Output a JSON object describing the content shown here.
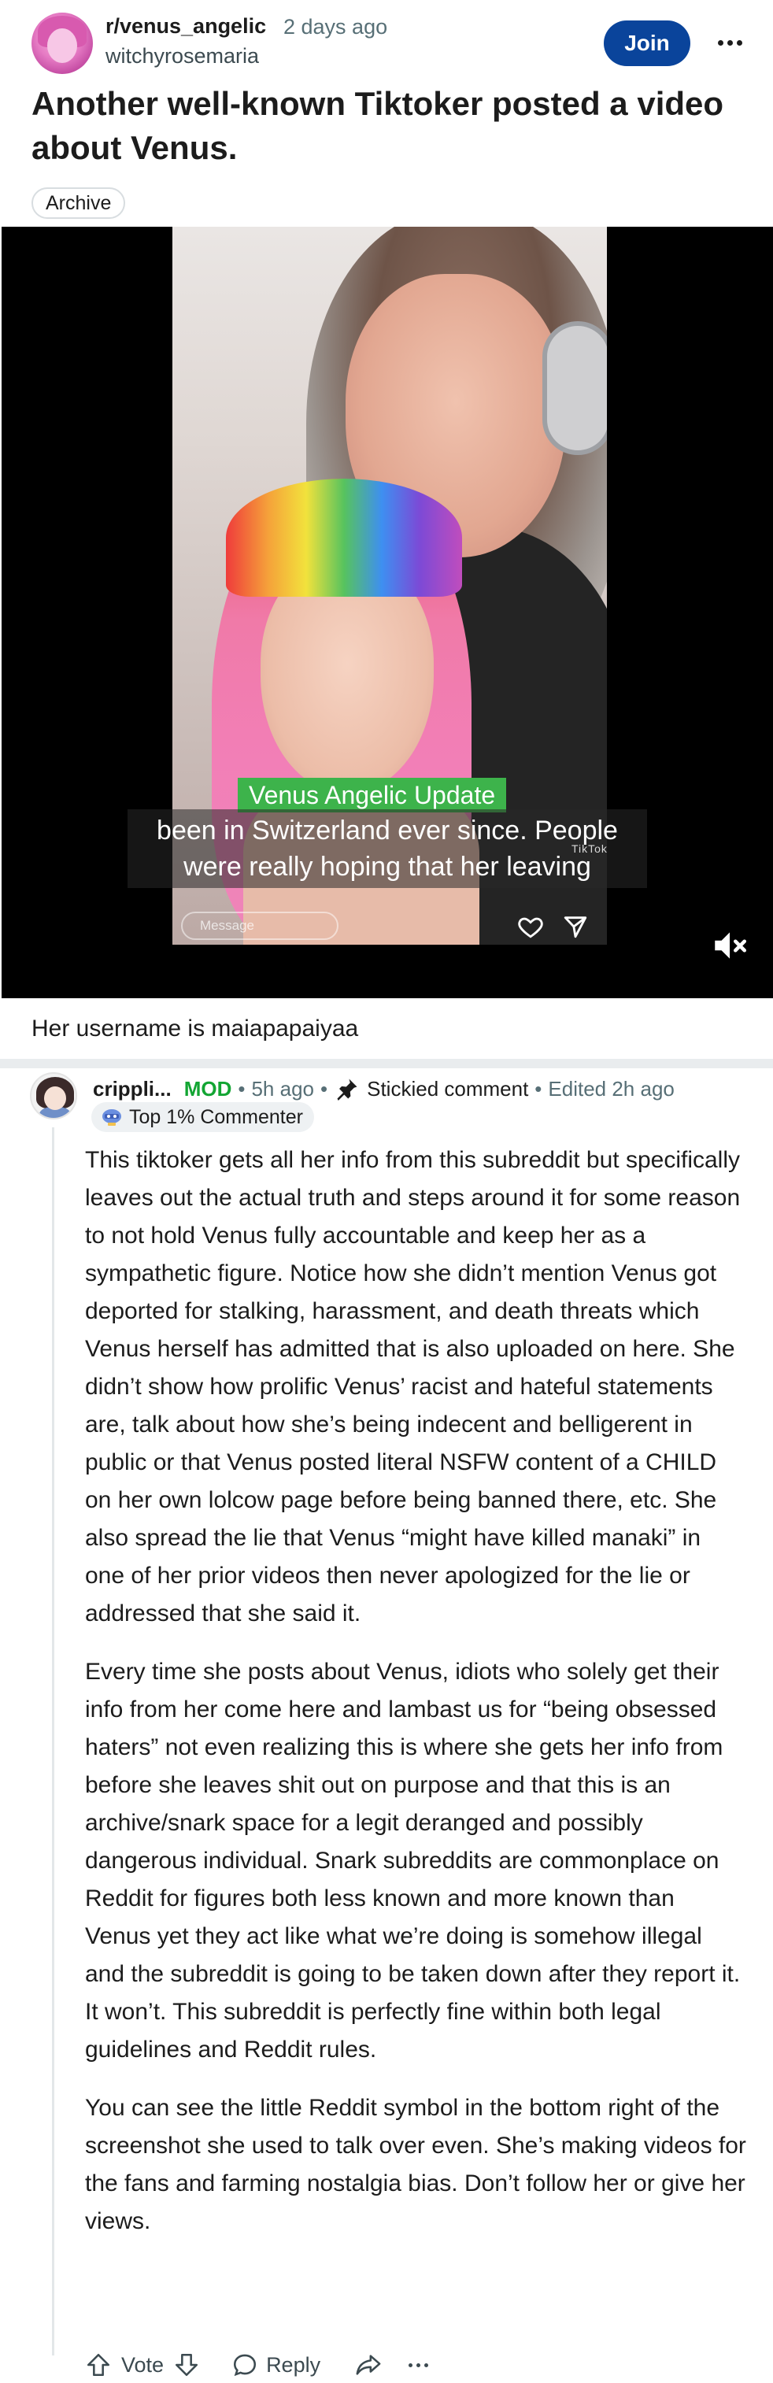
{
  "post": {
    "subreddit": "r/venus_angelic",
    "time": "2 days ago",
    "author": "witchyrosemaria",
    "join_label": "Join",
    "title": "Another well-known Tiktoker posted a video about Venus.",
    "flair": "Archive",
    "body": "Her username is maiapapaiyaa"
  },
  "video": {
    "overlay_label": "Venus Angelic Update",
    "caption": "been in Switzerland ever since. People were really hoping that her leaving",
    "watermark": "TikTok",
    "message_placeholder": "Message",
    "muted": true
  },
  "comment": {
    "username": "crippli...",
    "mod_label": "MOD",
    "time": "5h ago",
    "stickied": "Stickied comment",
    "edited": "Edited 2h ago",
    "badge": "Top 1% Commenter",
    "paragraphs": [
      "This tiktoker gets all her info from this subreddit but specifically leaves out the actual truth and steps around it for some reason to not hold Venus fully accountable and keep her as a sympathetic figure. Notice how she didn’t mention Venus got deported for stalking, harassment, and death threats which Venus herself has admitted that is also uploaded on here. She didn’t show how prolific Venus’ racist and hateful statements are, talk about how she’s being indecent and belligerent in public or that Venus posted literal NSFW content of a CHILD on her own lolcow page before being banned there, etc. She also spread the lie that Venus “might have killed manaki” in one of her prior videos then never apologized for the lie or addressed that she said it.",
      "Every time she posts about Venus, idiots who solely get their info from her come here and lambast us for “being obsessed haters” not even realizing this is where she gets her info from before she leaves shit out on purpose and that this is an archive/snark space for a legit deranged and possibly dangerous individual. Snark subreddits are commonplace on Reddit for figures both less known and more known than Venus yet they act like what we’re doing is somehow illegal and the subreddit is going to be taken down after they report it. It won’t. This subreddit is perfectly fine within both legal guidelines and Reddit rules.",
      "You can see the little Reddit symbol in the bottom right of the screenshot she used to talk over even. She’s making videos for the fans and farming nostalgia bias. Don’t follow her or give her views."
    ],
    "actions": {
      "vote": "Vote",
      "reply": "Reply"
    }
  },
  "colors": {
    "join_bg": "#0a449b",
    "mod_green": "#13a533",
    "meta_gray": "#576f76",
    "overlay_green": "#3db34b"
  },
  "icons": [
    "more-icon",
    "pin-icon",
    "trophy-icon",
    "heart-icon",
    "send-icon",
    "mute-icon",
    "upvote-icon",
    "downvote-icon",
    "reply-icon",
    "share-icon"
  ]
}
